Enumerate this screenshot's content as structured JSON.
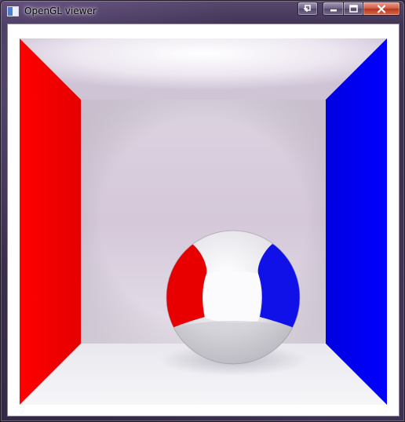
{
  "window": {
    "title": "OpenGL viewer",
    "buttons": {
      "extra_icon": "restore-window-icon",
      "minimize_icon": "minimize-icon",
      "maximize_icon": "maximize-icon",
      "close_icon": "close-icon"
    }
  },
  "scene": {
    "description_colors": {
      "left_wall": "#ff0000",
      "right_wall": "#0000ff",
      "back_wall": "#d7cfdc",
      "floor": "#e6e6ec",
      "ceiling": "#f4f2f6",
      "sphere": "#e8e8ee"
    }
  }
}
